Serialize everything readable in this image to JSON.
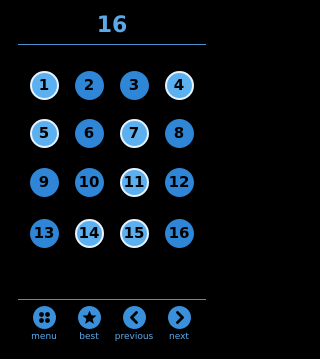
{
  "level_title": "16",
  "cells": [
    {
      "label": "1",
      "lit": true
    },
    {
      "label": "2",
      "lit": false
    },
    {
      "label": "3",
      "lit": false
    },
    {
      "label": "4",
      "lit": true
    },
    {
      "label": "5",
      "lit": true
    },
    {
      "label": "6",
      "lit": false
    },
    {
      "label": "7",
      "lit": true
    },
    {
      "label": "8",
      "lit": false
    },
    {
      "label": "9",
      "lit": false
    },
    {
      "label": "10",
      "lit": false
    },
    {
      "label": "11",
      "lit": true
    },
    {
      "label": "12",
      "lit": false
    },
    {
      "label": "13",
      "lit": false
    },
    {
      "label": "14",
      "lit": true
    },
    {
      "label": "15",
      "lit": true
    },
    {
      "label": "16",
      "lit": false
    }
  ],
  "nav": {
    "menu_label": "menu",
    "best_label": "best",
    "previous_label": "previous",
    "next_label": "next"
  },
  "colors": {
    "background": "#000000",
    "accent": "#5aa9e8",
    "cell": "#2f86d6",
    "cell_lit": "#5db0ef",
    "cell_ring": "#e6f3ff"
  }
}
